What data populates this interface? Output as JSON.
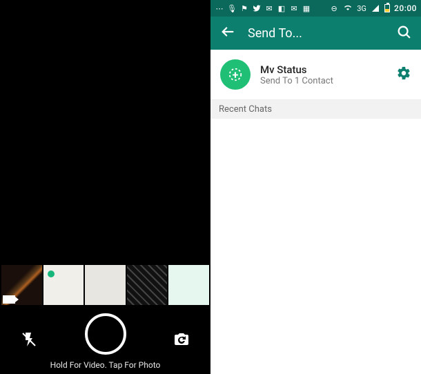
{
  "camera": {
    "hint": "Hold For Video. Tap For Photo",
    "thumbs": [
      "photo-1",
      "photo-2",
      "photo-3",
      "photo-4",
      "photo-5"
    ]
  },
  "statusbar": {
    "network_label": "3G",
    "time": "20:00"
  },
  "appbar": {
    "title": "Send To..."
  },
  "status_row": {
    "title": "Mv Status",
    "subtitle": "Send To 1 Contact"
  },
  "sections": {
    "recent_chats_label": "Recent Chats"
  }
}
